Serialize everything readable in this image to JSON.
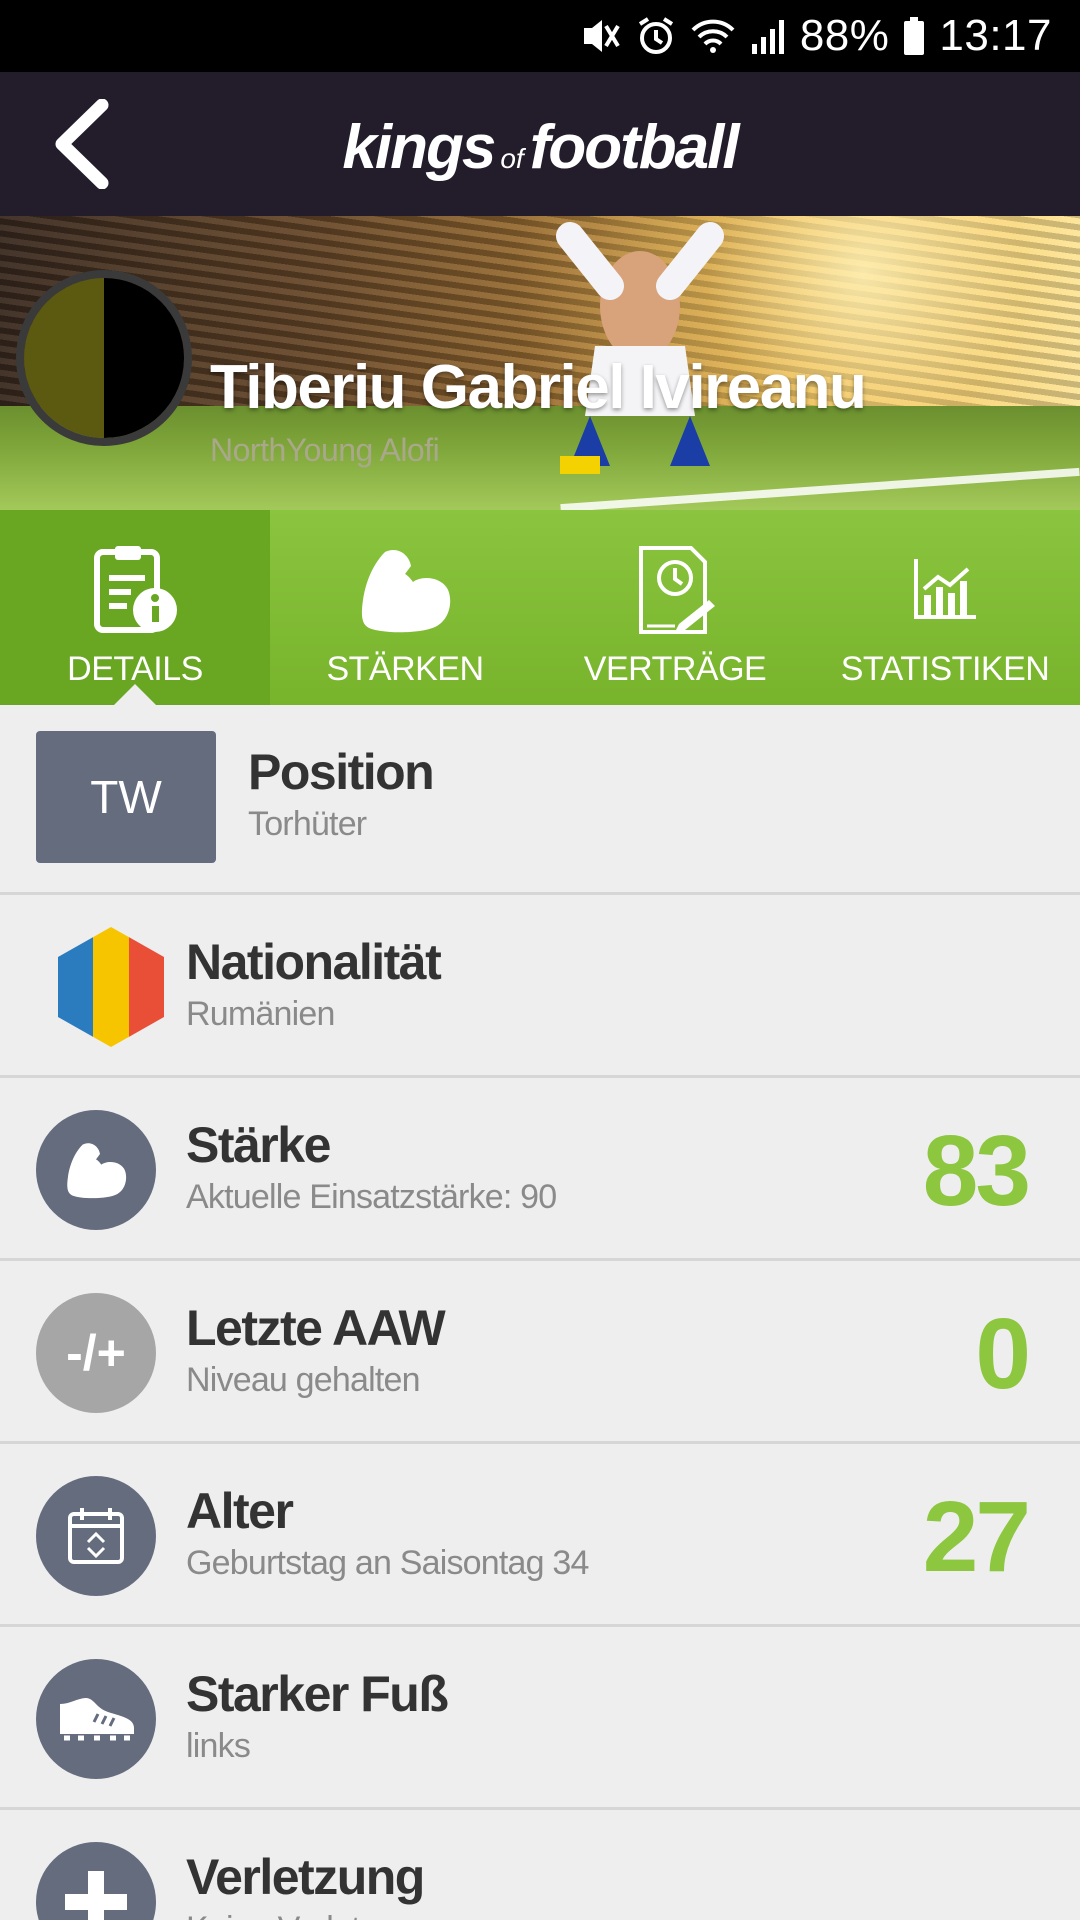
{
  "status_bar": {
    "battery_percent": "88%",
    "time": "13:17"
  },
  "header": {
    "logo_word1": "kings",
    "logo_word2": "of",
    "logo_word3": "football"
  },
  "player": {
    "name": "Tiberiu Gabriel Ivireanu",
    "club": "NorthYoung Alofi",
    "club_colors": [
      "#5c5a10",
      "#000000"
    ]
  },
  "tabs": [
    {
      "label": "DETAILS",
      "icon": "details-info-icon",
      "active": true
    },
    {
      "label": "STÄRKEN",
      "icon": "flexed-arm-icon",
      "active": false
    },
    {
      "label": "VERTRÄGE",
      "icon": "contract-clock-icon",
      "active": false
    },
    {
      "label": "STATISTIKEN",
      "icon": "bar-chart-icon",
      "active": false
    }
  ],
  "rows": {
    "position": {
      "badge": "TW",
      "title": "Position",
      "sub": "Torhüter"
    },
    "nationality": {
      "title": "Nationalität",
      "sub": "Rumänien",
      "flag_colors": [
        "#2b7bbf",
        "#f6c500",
        "#e94f37"
      ]
    },
    "strength": {
      "title": "Stärke",
      "sub": "Aktuelle Einsatzstärke: 90",
      "value": "83"
    },
    "last_aaw": {
      "icon_text": "-/+",
      "title": "Letzte AAW",
      "sub": "Niveau gehalten",
      "value": "0"
    },
    "age": {
      "title": "Alter",
      "sub": "Geburtstag an Saisontag 34",
      "value": "27"
    },
    "strong_foot": {
      "title": "Starker Fuß",
      "sub": "links"
    },
    "injury": {
      "title": "Verletzung",
      "sub": "Keine Verletzung"
    }
  },
  "colors": {
    "accent_green": "#8dc63f",
    "header_bg": "#221c2b",
    "icon_circle": "#646c7e"
  }
}
